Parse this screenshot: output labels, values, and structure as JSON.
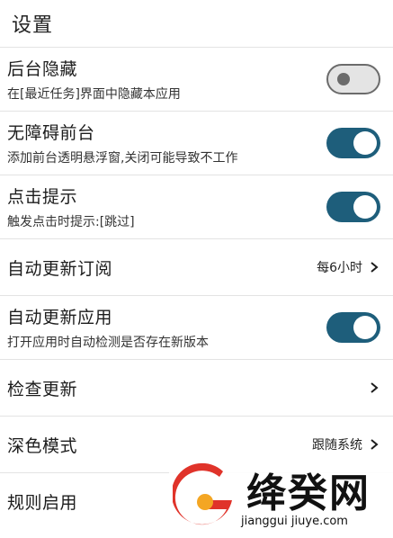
{
  "header": {
    "title": "设置"
  },
  "settings": {
    "hide_recent": {
      "title": "后台隐藏",
      "subtitle": "在[最近任务]界面中隐藏本应用",
      "enabled": false
    },
    "accessibility_fg": {
      "title": "无障碍前台",
      "subtitle": "添加前台透明悬浮窗,关闭可能导致不工作",
      "enabled": true
    },
    "click_hint": {
      "title": "点击提示",
      "subtitle": "触发点击时提示:[跳过]",
      "enabled": true
    },
    "auto_update_sub": {
      "title": "自动更新订阅",
      "value": "每6小时"
    },
    "auto_update_app": {
      "title": "自动更新应用",
      "subtitle": "打开应用时自动检测是否存在新版本",
      "enabled": true
    },
    "check_update": {
      "title": "检查更新"
    },
    "dark_mode": {
      "title": "深色模式",
      "value": "跟随系统"
    },
    "rule_enable": {
      "title": "规则启用"
    }
  },
  "watermark": {
    "name": "绛癸网",
    "url": "jianggui jiuye.com"
  },
  "colors": {
    "toggle_on": "#1e5e7b",
    "toggle_off": "#e4e4e4",
    "divider": "#e3e3e3"
  }
}
